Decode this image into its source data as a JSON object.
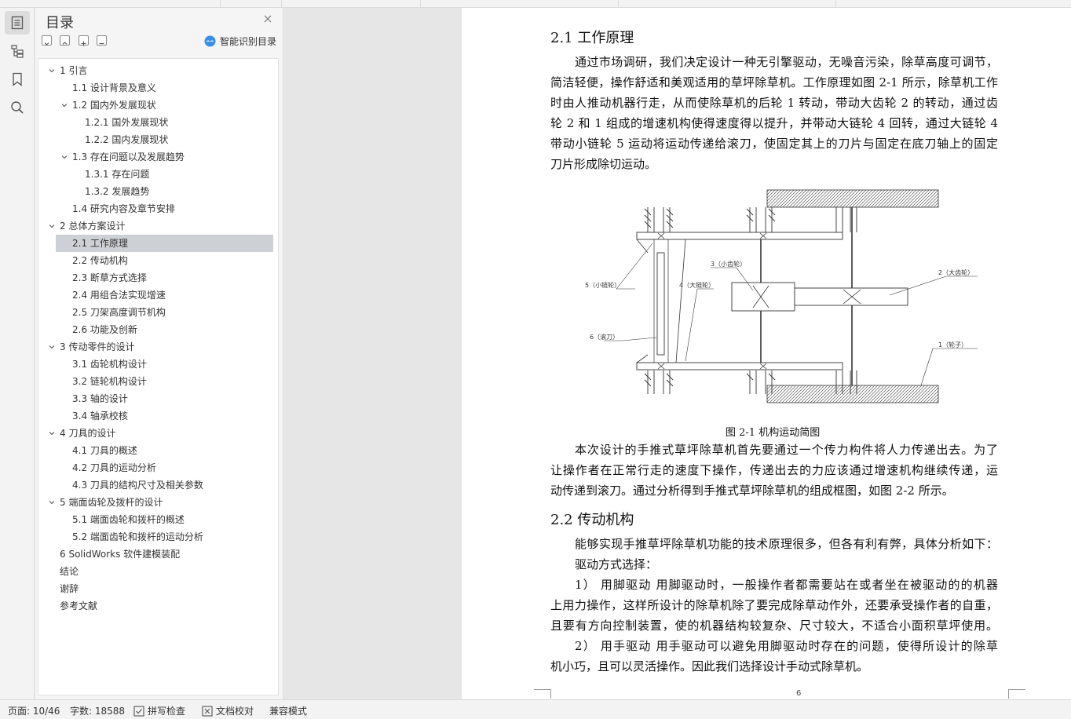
{
  "toc": {
    "title": "目录",
    "smart_label": "智能识别目录",
    "items": [
      {
        "label": "1 引言",
        "level": 0,
        "expandable": true
      },
      {
        "label": "1.1 设计背景及意义",
        "level": 1
      },
      {
        "label": "1.2 国内外发展现状",
        "level": 1,
        "expandable": true
      },
      {
        "label": "1.2.1 国外发展现状",
        "level": 2
      },
      {
        "label": "1.2.2 国内发展现状",
        "level": 2
      },
      {
        "label": "1.3 存在问题以及发展趋势",
        "level": 1,
        "expandable": true
      },
      {
        "label": "1.3.1 存在问题",
        "level": 2
      },
      {
        "label": "1.3.2 发展趋势",
        "level": 2
      },
      {
        "label": "1.4 研究内容及章节安排",
        "level": 1
      },
      {
        "label": "2 总体方案设计",
        "level": 0,
        "expandable": true
      },
      {
        "label": "2.1 工作原理",
        "level": 1,
        "selected": true
      },
      {
        "label": "2.2 传动机构",
        "level": 1
      },
      {
        "label": "2.3 断草方式选择",
        "level": 1
      },
      {
        "label": "2.4 用组合法实现增速",
        "level": 1
      },
      {
        "label": "2.5 刀架高度调节机构",
        "level": 1
      },
      {
        "label": "2.6 功能及创新",
        "level": 1
      },
      {
        "label": "3 传动零件的设计",
        "level": 0,
        "expandable": true
      },
      {
        "label": "3.1 齿轮机构设计",
        "level": 1
      },
      {
        "label": "3.2 链轮机构设计",
        "level": 1
      },
      {
        "label": "3.3 轴的设计",
        "level": 1
      },
      {
        "label": "3.4 轴承校核",
        "level": 1
      },
      {
        "label": "4 刀具的设计",
        "level": 0,
        "expandable": true
      },
      {
        "label": "4.1  刀具的概述",
        "level": 1
      },
      {
        "label": "4.2 刀具的运动分析",
        "level": 1
      },
      {
        "label": "4.3 刀具的结构尺寸及相关参数",
        "level": 1
      },
      {
        "label": "5 端面齿轮及拨杆的设计",
        "level": 0,
        "expandable": true
      },
      {
        "label": "5.1 端面齿轮和拨杆的概述",
        "level": 1
      },
      {
        "label": "5.2  端面齿轮和拨杆的运动分析",
        "level": 1
      },
      {
        "label": "6 SolidWorks 软件建模装配",
        "level": 0
      },
      {
        "label": "结论",
        "level": 0
      },
      {
        "label": "谢辞",
        "level": 0
      },
      {
        "label": "参考文献",
        "level": 0
      }
    ]
  },
  "document": {
    "heading_1": "2.1 工作原理",
    "para_1": [
      "通过市场调研，我们决定设计一种无引擎驱动，无噪音污染，除草高度可调节，",
      "简洁轻便，操作舒适和美观适用的草坪除草机。工作原理如图 2-1 所示，除草机工作",
      "时由人推动机器行走，从而使除草机的后轮 1 转动，带动大齿轮 2 的转动，通过齿",
      "轮 2 和 1 组成的增速机构使得速度得以提升，并带动大链轮 4 回转，通过大链轮 4",
      "带动小链轮 5 运动将运动传递给滚刀，使固定其上的刀片与固定在底刀轴上的固定",
      "刀片形成除切运动。"
    ],
    "figure_labels": {
      "l3": "3（小齿轮）",
      "l2": "2（大齿轮）",
      "l5": "5（小链轮）",
      "l4": "4（大链轮）",
      "l6": "6（滚刀）",
      "l1": "1（轮子）"
    },
    "caption": "图 2-1   机构运动简图",
    "para_2": [
      "本次设计的手推式草坪除草机首先要通过一个传力构件将人力传递出去。为了",
      "让操作者在正常行走的速度下操作，传递出去的力应该通过增速机构继续传递，运",
      "动传递到滚刀。通过分析得到手推式草坪除草机的组成框图，如图 2-2 所示。"
    ],
    "heading_2": "2.2 传动机构",
    "para_3": [
      "能够实现手推草坪除草机功能的技术原理很多，但各有利有弊，具体分析如下：",
      "驱动方式选择：",
      "1）  用脚驱动    用脚驱动时，一般操作者都需要站在或者坐在被驱动的的机器",
      "上用力操作，这样所设计的除草机除了要完成除草动作外，还要承受操作者的自重，",
      "且要有方向控制装置，使的机器结构较复杂、尺寸较大，不适合小面积草坪使用。",
      "2）  用手驱动    用手驱动可以避免用脚驱动时存在的问题，使得所设计的除草",
      "机小巧，且可以灵活操作。因此我们选择设计手动式除草机。"
    ],
    "page_number": "6"
  },
  "status": {
    "page": "页面: 10/46",
    "words": "字数: 18588",
    "spell": "拼写检查",
    "proof": "文档校对",
    "compat": "兼容模式"
  }
}
